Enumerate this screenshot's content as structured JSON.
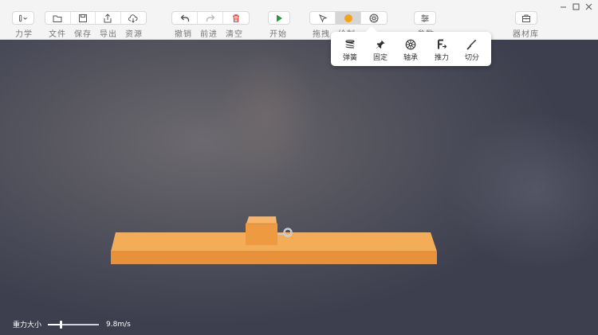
{
  "toolbar": {
    "mode_label": "力学",
    "file_labels": [
      "文件",
      "保存",
      "导出",
      "资源"
    ],
    "edit_labels": [
      "撤销",
      "前进",
      "清空"
    ],
    "start_label": "开始",
    "drag_label": "拖拽",
    "draw_label": "绘制",
    "draw_hidden_label": "",
    "params_label": "参数",
    "library_label": "器材库"
  },
  "popup": {
    "items": [
      "弹簧",
      "固定",
      "轴承",
      "推力",
      "切分"
    ]
  },
  "gravity": {
    "label": "重力大小",
    "value_text": "9.8m/s",
    "slider_fraction": 0.25
  },
  "colors": {
    "accent_orange": "#f5a21b",
    "play_green": "#1f9d3a",
    "clear_red": "#d9342b",
    "board_orange": "#f0a04a"
  }
}
